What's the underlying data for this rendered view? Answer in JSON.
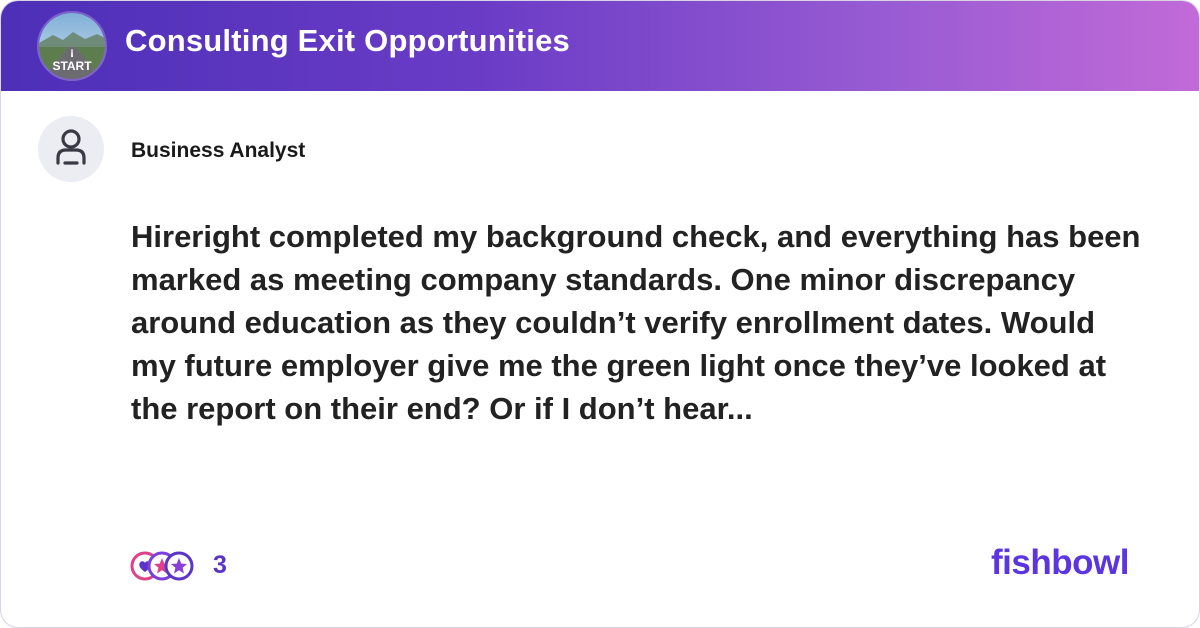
{
  "header": {
    "title": "Consulting Exit Opportunities",
    "avatar_icon": "road-start-image-icon",
    "avatar_text": "START",
    "gradient": [
      "#4d2fb8",
      "#c26ad8"
    ]
  },
  "post": {
    "author": "Business Analyst",
    "author_icon": "user-icon",
    "body": "Hireright completed my background check, and everything has been marked as meeting company standards. One minor discrepancy around education as they couldn’t verify enrollment dates. Would my future employer give me the green light once they’ve looked at the report on their end? Or if I don’t hear..."
  },
  "reactions": {
    "icons": [
      "heart-reaction-icon",
      "star-reaction-icon",
      "star-reaction-icon"
    ],
    "count": "3"
  },
  "brand": {
    "name": "fishbowl",
    "color": "#5a35e0"
  }
}
